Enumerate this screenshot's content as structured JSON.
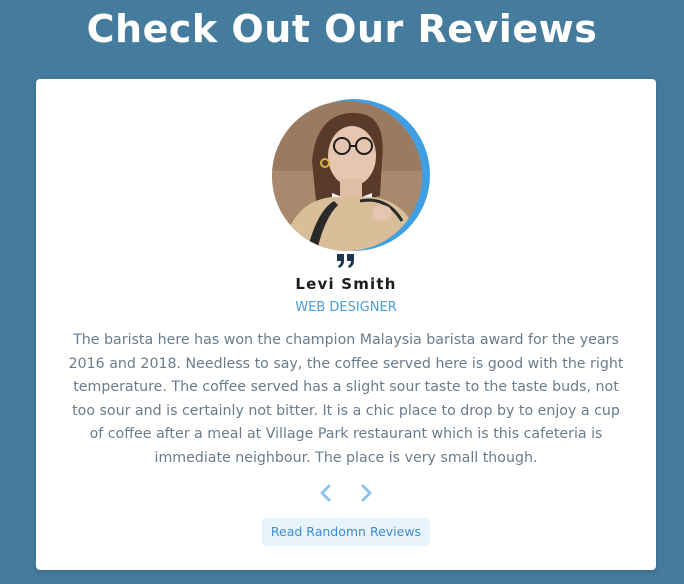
{
  "page": {
    "title": "Check Out Our Reviews"
  },
  "review": {
    "name": "Levi Smith",
    "role": "Web Designer",
    "text": "The barista here has won the champion Malaysia barista award for the years 2016 and 2018. Needless to say, the coffee served here is good with the right temperature. The coffee served has a slight sour taste to the taste buds, not too sour and is certainly not bitter. It is a chic place to drop by to enjoy a cup of coffee after a meal at Village Park restaurant which is this cafeteria is immediate neighbour. The place is very small though."
  },
  "controls": {
    "prev_icon": "chevron-left-icon",
    "next_icon": "chevron-right-icon",
    "random_label": "Read Randomn Reviews"
  },
  "colors": {
    "background": "#457b9d",
    "accent": "#3f9fe3",
    "role_text": "#4b9ed9",
    "body_text": "#6a7c8c",
    "button_bg": "#e8f3fc"
  },
  "icons": {
    "quote": "quote-icon",
    "avatar": "avatar"
  }
}
